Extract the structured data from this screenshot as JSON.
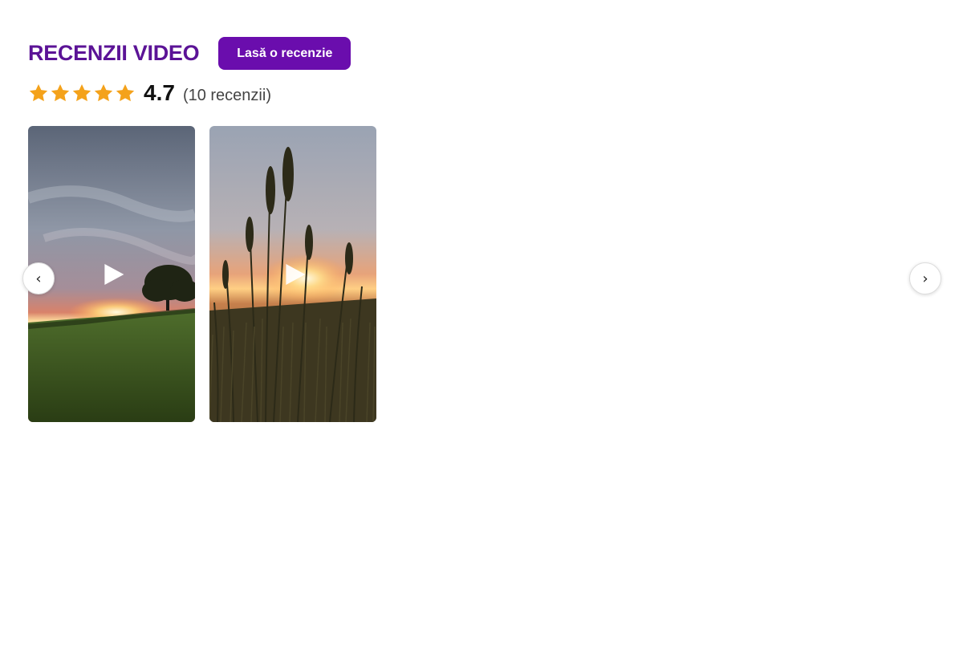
{
  "header": {
    "title": "RECENZII VIDEO",
    "cta_label": "Lasă o recenzie"
  },
  "rating": {
    "stars": 5,
    "score": "4.7",
    "count_label": "(10 recenzii)",
    "star_color": "#f4a21b"
  },
  "carousel": {
    "prev_label": "‹",
    "next_label": "›",
    "videos": [
      {
        "thumbnail": "sunset over green field with tree",
        "play_icon": "play-icon"
      },
      {
        "thumbnail": "sunset through tall grass",
        "play_icon": "play-icon"
      }
    ]
  },
  "colors": {
    "title": "#5b1396",
    "button": "#6a0dad"
  }
}
